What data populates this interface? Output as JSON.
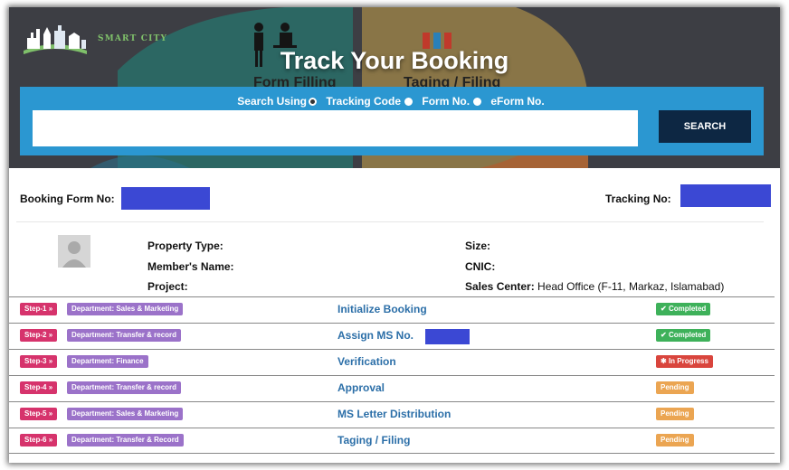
{
  "hero": {
    "logo_text": "SMART CITY",
    "title": "Track Your Booking",
    "bg_label_left": "Form Filling",
    "bg_label_right": "Taging / Filing"
  },
  "search": {
    "using_label": "Search Using",
    "options": [
      "Tracking Code",
      "Form No.",
      "eForm No."
    ],
    "selected": "Search Using",
    "input_value": "",
    "button_label": "SEARCH"
  },
  "booking": {
    "form_no_label": "Booking Form No:",
    "tracking_no_label": "Tracking No:",
    "fields_left": [
      {
        "label": "Property Type:",
        "value": ""
      },
      {
        "label": "Member's Name:",
        "value": ""
      },
      {
        "label": "Project:",
        "value": ""
      }
    ],
    "fields_right": [
      {
        "label": "Size:",
        "value": ""
      },
      {
        "label": "CNIC:",
        "value": ""
      },
      {
        "label": "Sales Center:",
        "value": "Head Office (F-11, Markaz, Islamabad)"
      }
    ]
  },
  "steps": [
    {
      "step": "Step-1",
      "department": "Department: Sales & Marketing",
      "title": "Initialize Booking",
      "status": "Completed",
      "status_type": "completed"
    },
    {
      "step": "Step-2",
      "department": "Department: Transfer & record",
      "title": "Assign MS No.",
      "status": "Completed",
      "status_type": "completed"
    },
    {
      "step": "Step-3",
      "department": "Department: Finance",
      "title": "Verification",
      "status": "In Progress",
      "status_type": "progress"
    },
    {
      "step": "Step-4",
      "department": "Department: Transfer & record",
      "title": "Approval",
      "status": "Pending",
      "status_type": "pending"
    },
    {
      "step": "Step-5",
      "department": "Department: Sales & Marketing",
      "title": "MS Letter Distribution",
      "status": "Pending",
      "status_type": "pending"
    },
    {
      "step": "Step-6",
      "department": "Department: Transfer & Record",
      "title": "Taging / Filing",
      "status": "Pending",
      "status_type": "pending"
    }
  ],
  "icons": {
    "step_suffix": "»",
    "completed": "✔",
    "progress": "✱"
  },
  "colors": {
    "search_panel": "#2b97d1",
    "search_button": "#0d2743",
    "step_badge": "#d6336c",
    "dept_badge": "#9b72c9",
    "completed": "#3eb15a",
    "in_progress": "#d9453d",
    "pending": "#eba552",
    "redaction": "#3b48d4"
  }
}
